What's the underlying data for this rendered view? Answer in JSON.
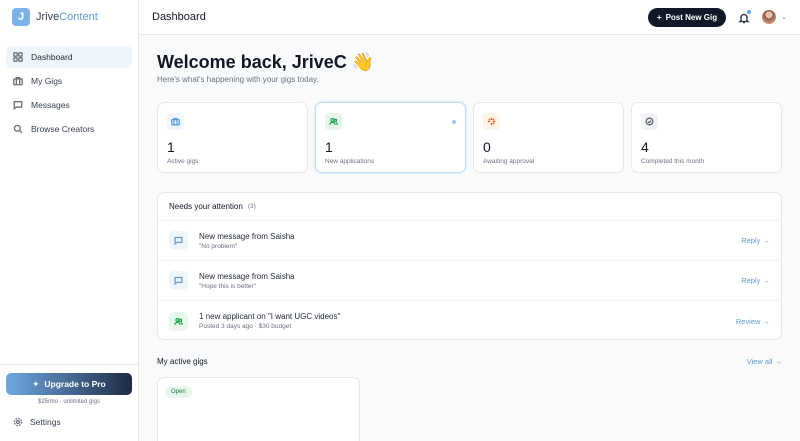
{
  "brand": {
    "logo_letter": "J",
    "name_prefix": "Jrive",
    "name_suffix": "Content"
  },
  "sidebar": {
    "items": [
      {
        "label": "Dashboard",
        "icon": "grid-icon",
        "active": true
      },
      {
        "label": "My Gigs",
        "icon": "briefcase-icon",
        "active": false
      },
      {
        "label": "Messages",
        "icon": "message-icon",
        "active": false
      },
      {
        "label": "Browse Creators",
        "icon": "search-icon",
        "active": false
      }
    ],
    "upgrade_label": "Upgrade to Pro",
    "upgrade_note": "$25/mo · unlimited gigs",
    "settings_label": "Settings"
  },
  "header": {
    "title": "Dashboard",
    "post_button": "Post New Gig",
    "chevron": "⌄"
  },
  "welcome": {
    "title": "Welcome back, JriveC 👋",
    "subtitle": "Here's what's happening with your gigs today."
  },
  "stats": [
    {
      "value": "1",
      "label": "Active gigs",
      "icon": "briefcase-icon",
      "color": "#5b9bd5",
      "bg": "#eef5fc"
    },
    {
      "value": "1",
      "label": "New applications",
      "icon": "users-icon",
      "color": "#16a34a",
      "bg": "#e7f7ec"
    },
    {
      "value": "0",
      "label": "Awaiting approval",
      "icon": "sparkle-icon",
      "color": "#ea580c",
      "bg": "#fff4e8"
    },
    {
      "value": "4",
      "label": "Completed this month",
      "icon": "check-circle-icon",
      "color": "#4b5563",
      "bg": "#f1f3f6"
    }
  ],
  "attention": {
    "title": "Needs your attention",
    "count": "(3)",
    "items": [
      {
        "title": "New message from Saisha",
        "sub": "\"No problem\"",
        "action": "Reply →",
        "icon": "message-icon"
      },
      {
        "title": "New message from Saisha",
        "sub": "\"Hope this is better\"",
        "action": "Reply →",
        "icon": "message-icon"
      },
      {
        "title": "1 new applicant on \"I want UGC videos\"",
        "sub": "Posted 3 days ago · $30 budget",
        "action": "Review →",
        "icon": "users-icon"
      }
    ]
  },
  "active_gigs": {
    "title": "My active gigs",
    "view_all": "View all →",
    "cards": [
      {
        "status": "Open"
      }
    ]
  },
  "colors": {
    "accent": "#5b9bd5",
    "dark": "#111827",
    "success": "#16a34a"
  }
}
